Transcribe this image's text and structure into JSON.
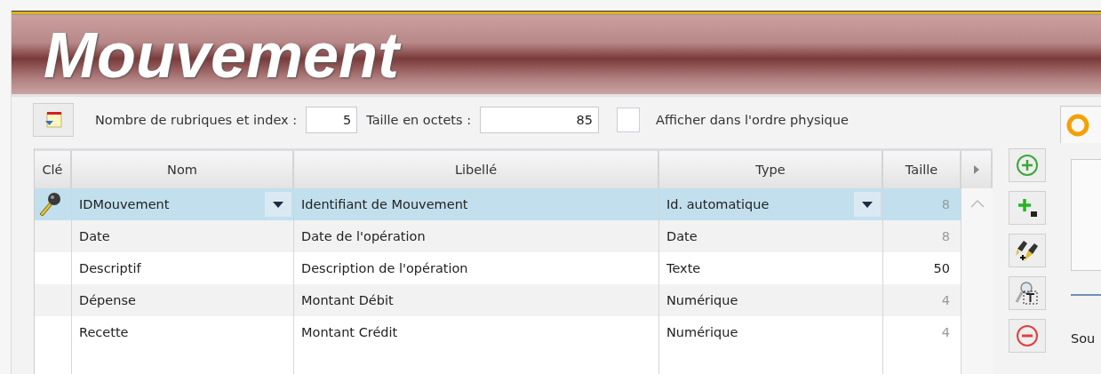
{
  "title": "Mouvement",
  "toolbar": {
    "count_label": "Nombre de rubriques et index :",
    "count_value": "5",
    "size_label": "Taille en octets :",
    "size_value": "85",
    "physical_order": {
      "label": "Afficher dans l'ordre physique",
      "checked": false
    }
  },
  "table": {
    "columns": [
      "Clé",
      "Nom",
      "Libellé",
      "Type",
      "Taille"
    ],
    "rows": [
      {
        "key": true,
        "name": "IDMouvement",
        "label": "Identifiant de Mouvement",
        "type": "Id. automatique",
        "size": "8",
        "size_disabled": true,
        "selected": true
      },
      {
        "key": false,
        "name": "Date",
        "label": "Date de l'opération",
        "type": "Date",
        "size": "8",
        "size_disabled": true,
        "selected": false
      },
      {
        "key": false,
        "name": "Descriptif",
        "label": "Description de l'opération",
        "type": "Texte",
        "size": "50",
        "size_disabled": false,
        "selected": false
      },
      {
        "key": false,
        "name": "Dépense",
        "label": "Montant Débit",
        "type": "Numérique",
        "size": "4",
        "size_disabled": true,
        "selected": false
      },
      {
        "key": false,
        "name": "Recette",
        "label": "Montant Crédit",
        "type": "Numérique",
        "size": "4",
        "size_disabled": true,
        "selected": false
      }
    ]
  },
  "side_panel": {
    "text": "Sou"
  }
}
